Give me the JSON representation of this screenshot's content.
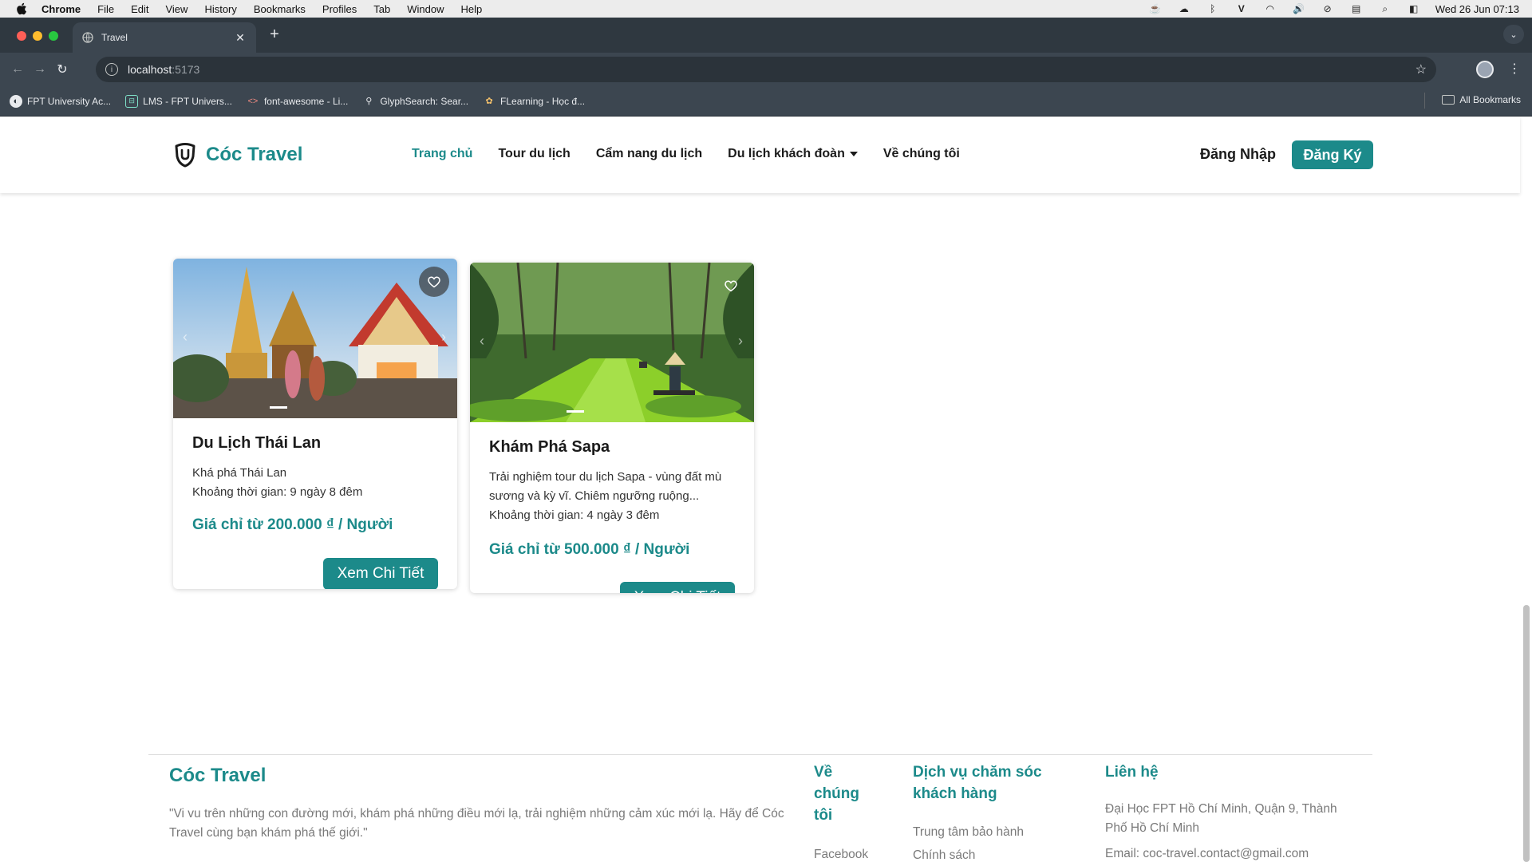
{
  "mac_menubar": {
    "apple": "",
    "items": [
      "Chrome",
      "File",
      "Edit",
      "View",
      "History",
      "Bookmarks",
      "Profiles",
      "Tab",
      "Window",
      "Help"
    ],
    "clock": "Wed 26 Jun  07:13"
  },
  "browser": {
    "tab_title": "Travel",
    "new_tab": "+",
    "url_host": "localhost",
    "url_port": ":5173",
    "bookmarks": [
      "FPT University Ac...",
      "LMS - FPT Univers...",
      "font-awesome - Li...",
      "GlyphSearch: Sear...",
      "FLearning - Học đ..."
    ],
    "all_bookmarks": "All Bookmarks"
  },
  "site": {
    "brand": "Cóc Travel",
    "nav": [
      "Trang chủ",
      "Tour du lịch",
      "Cẩm nang du lịch",
      "Du lịch khách đoàn",
      "Về chúng tôi"
    ],
    "login": "Đăng Nhập",
    "register": "Đăng Ký"
  },
  "tours": [
    {
      "title": "Du Lịch Thái Lan",
      "desc": "Khá phá Thái Lan",
      "duration": "Khoảng thời gian: 9 ngày 8 đêm",
      "price": "Giá chỉ từ 200.000 ₫ / Người",
      "button": "Xem Chi Tiết"
    },
    {
      "title": "Khám Phá Sapa",
      "desc": "Trải nghiệm tour du lịch Sapa - vùng đất mù sương và kỳ vĩ. Chiêm ngưỡng ruộng...",
      "duration": "Khoảng thời gian: 4 ngày 3 đêm",
      "price": "Giá chỉ từ 500.000 ₫ / Người",
      "button": "Xem Chi Tiết"
    }
  ],
  "footer": {
    "brand": "Cóc Travel",
    "quote": "\"Vi vu trên những con đường mới, khám phá những điều mới lạ, trải nghiệm những cảm xúc mới lạ. Hãy để Cóc Travel cùng bạn khám phá thế giới.\"",
    "about_title": "Về chúng tôi",
    "about_link": "Facebook",
    "service_title": "Dịch vụ chăm sóc khách hàng",
    "service_links": [
      "Trung tâm bảo hành",
      "Chính sách"
    ],
    "contact_title": "Liên hệ",
    "contact_address": "Đại Học FPT Hồ Chí Minh, Quận 9, Thành Phố Hồ Chí Minh",
    "contact_email": "Email: coc-travel.contact@gmail.com"
  },
  "colors": {
    "brand": "#1c8a8a"
  }
}
